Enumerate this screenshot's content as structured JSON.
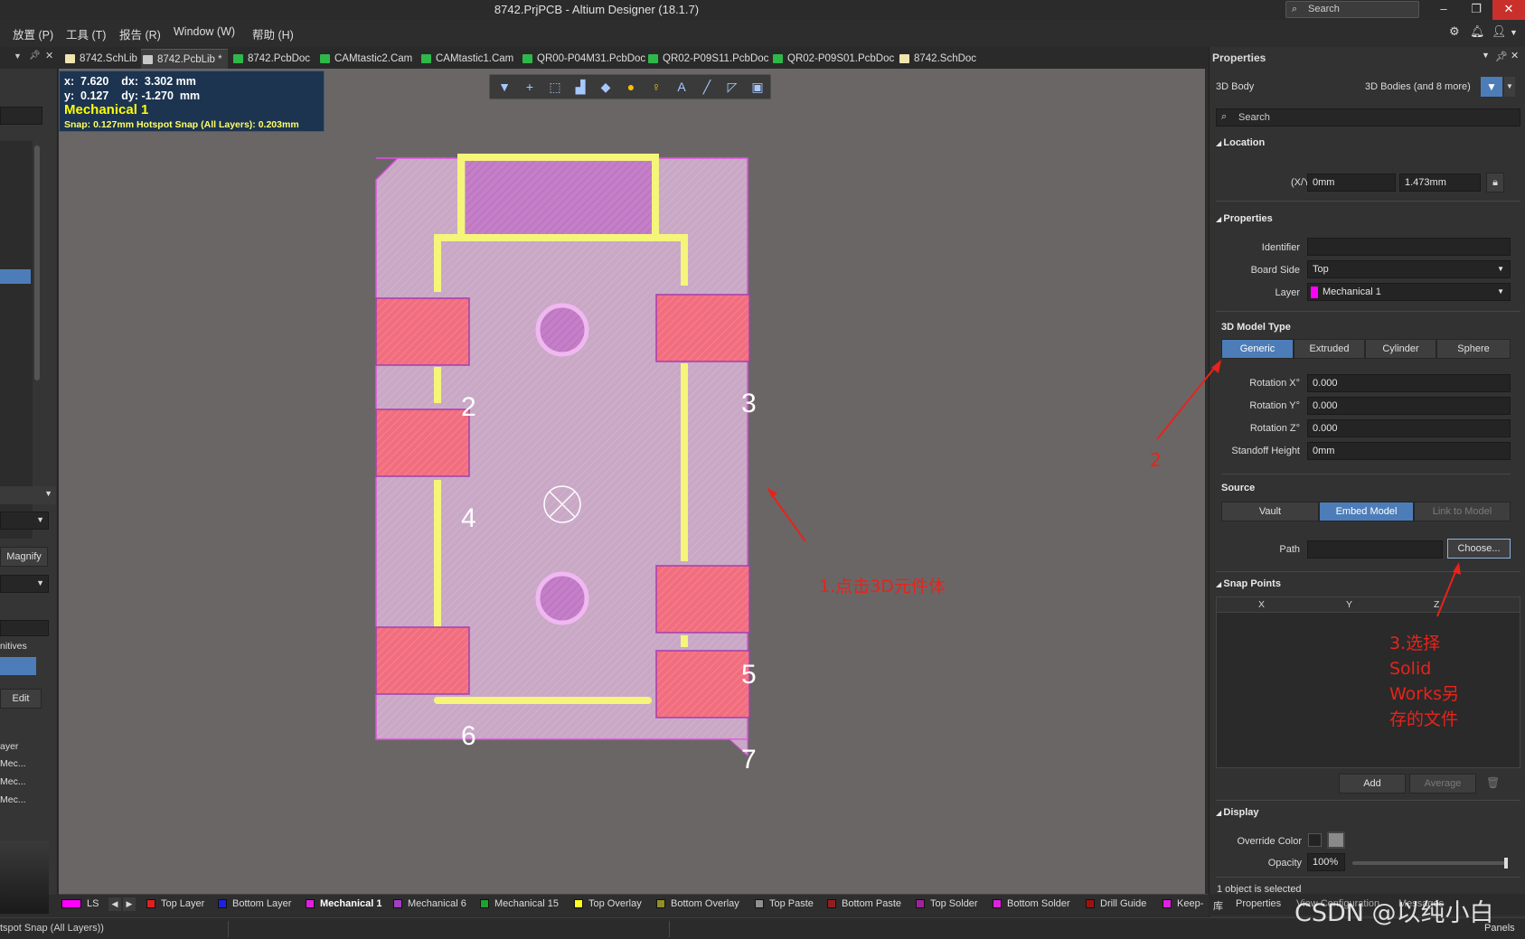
{
  "window": {
    "title": "8742.PrjPCB - Altium Designer (18.1.7)",
    "search_label": "Search",
    "minimize": "–",
    "restore": "❐",
    "close": "✕"
  },
  "menu": {
    "items": [
      "放置 (P)",
      "工具 (T)",
      "报告 (R)",
      "Window (W)",
      "帮助 (H)"
    ]
  },
  "tabs": [
    {
      "label": "8742.SchLib",
      "color": "#f0e4b0"
    },
    {
      "label": "8742.PcbLib *",
      "color": "#c8c8c8",
      "active": true
    },
    {
      "label": "8742.PcbDoc",
      "color": "#2fb84a"
    },
    {
      "label": "CAMtastic2.Cam",
      "color": "#2fb84a"
    },
    {
      "label": "CAMtastic1.Cam",
      "color": "#2fb84a"
    },
    {
      "label": "QR00-P04M31.PcbDoc",
      "color": "#2fb84a"
    },
    {
      "label": "QR02-P09S11.PcbDoc",
      "color": "#2fb84a"
    },
    {
      "label": "QR02-P09S01.PcbDoc",
      "color": "#2fb84a"
    },
    {
      "label": "8742.SchDoc",
      "color": "#f0e4b0"
    }
  ],
  "left_panel": {
    "magnify": "Magnify",
    "primitives": "nitives",
    "edit": "Edit",
    "layer_header": "ayer",
    "layers": [
      "Mec...",
      "Mec...",
      "Mec..."
    ]
  },
  "coords": {
    "line1": "x:  7.620    dx:  3.302 mm",
    "line2": "y:  0.127    dy: -1.270  mm",
    "layer": "Mechanical 1",
    "snap": "Snap: 0.127mm Hotspot Snap (All Layers): 0.203mm"
  },
  "toolbar_icons": [
    "filter-icon",
    "cross-icon",
    "select-rect-icon",
    "chart-icon",
    "eraser-icon",
    "pad-icon",
    "via-icon",
    "text-icon",
    "line-icon",
    "region-icon",
    "fill-icon"
  ],
  "pads": [
    {
      "label": "2"
    },
    {
      "label": "3"
    },
    {
      "label": "4"
    },
    {
      "label": "5"
    },
    {
      "label": "6"
    },
    {
      "label": "7"
    }
  ],
  "annotations": {
    "a1": "1.点击3D元件体",
    "a2": "2",
    "a3": [
      "3.选择",
      "Solid",
      "Works另",
      "存的文件"
    ]
  },
  "layer_tabs": [
    {
      "label": "LS",
      "color": "#ff00ff"
    },
    {
      "label": "Top Layer",
      "color": "#e02020"
    },
    {
      "label": "Bottom Layer",
      "color": "#2020e0"
    },
    {
      "label": "Mechanical 1",
      "color": "#e020e0",
      "active": true
    },
    {
      "label": "Mechanical 6",
      "color": "#a040c0"
    },
    {
      "label": "Mechanical 15",
      "color": "#20a030"
    },
    {
      "label": "Top Overlay",
      "color": "#ffff20"
    },
    {
      "label": "Bottom Overlay",
      "color": "#909020"
    },
    {
      "label": "Top Paste",
      "color": "#909090"
    },
    {
      "label": "Bottom Paste",
      "color": "#902020"
    },
    {
      "label": "Top Solder",
      "color": "#a020a0"
    },
    {
      "label": "Bottom Solder",
      "color": "#e020e0"
    },
    {
      "label": "Drill Guide",
      "color": "#a01010"
    },
    {
      "label": "Keep-",
      "color": "#e020e0"
    }
  ],
  "status": {
    "left": "tspot Snap (All Layers))",
    "panels": "Panels",
    "bottom_tabs": [
      "库",
      "Properties",
      "View Configuration",
      "Messages"
    ],
    "selected": "1 object is selected",
    "watermark": "CSDN @以纯小白"
  },
  "properties": {
    "header": "Properties",
    "object_type": "3D Body",
    "filter_label": "3D Bodies (and 8 more)",
    "search_placeholder": "Search",
    "location_section": "Location",
    "xy_label": "(X/Y)",
    "x": "0mm",
    "y": "1.473mm",
    "props_section": "Properties",
    "identifier_label": "Identifier",
    "identifier": "",
    "board_side_label": "Board Side",
    "board_side": "Top",
    "layer_label": "Layer",
    "layer": "Mechanical 1",
    "layer_color": "#ff00ff",
    "model_type_section": "3D Model Type",
    "model_types": [
      "Generic",
      "Extruded",
      "Cylinder",
      "Sphere"
    ],
    "rot_x_label": "Rotation X°",
    "rot_x": "0.000",
    "rot_y_label": "Rotation Y°",
    "rot_y": "0.000",
    "rot_z_label": "Rotation Z°",
    "rot_z": "0.000",
    "standoff_label": "Standoff Height",
    "standoff": "0mm",
    "source_section": "Source",
    "source_buttons": [
      "Vault",
      "Embed Model",
      "Link to Model"
    ],
    "path_label": "Path",
    "path": "",
    "choose": "Choose...",
    "snap_section": "Snap Points",
    "snap_cols": [
      "X",
      "Y",
      "Z"
    ],
    "add": "Add",
    "average": "Average",
    "display_section": "Display",
    "override_label": "Override Color",
    "opacity_label": "Opacity",
    "opacity": "100%"
  },
  "colors": {
    "canvas": "#6a6666",
    "board": "#c9a8c6",
    "pad": "#f26e7e",
    "overlay": "#f5f57a",
    "selected_blue": "#4d7db8",
    "annotation": "#e8231a"
  }
}
